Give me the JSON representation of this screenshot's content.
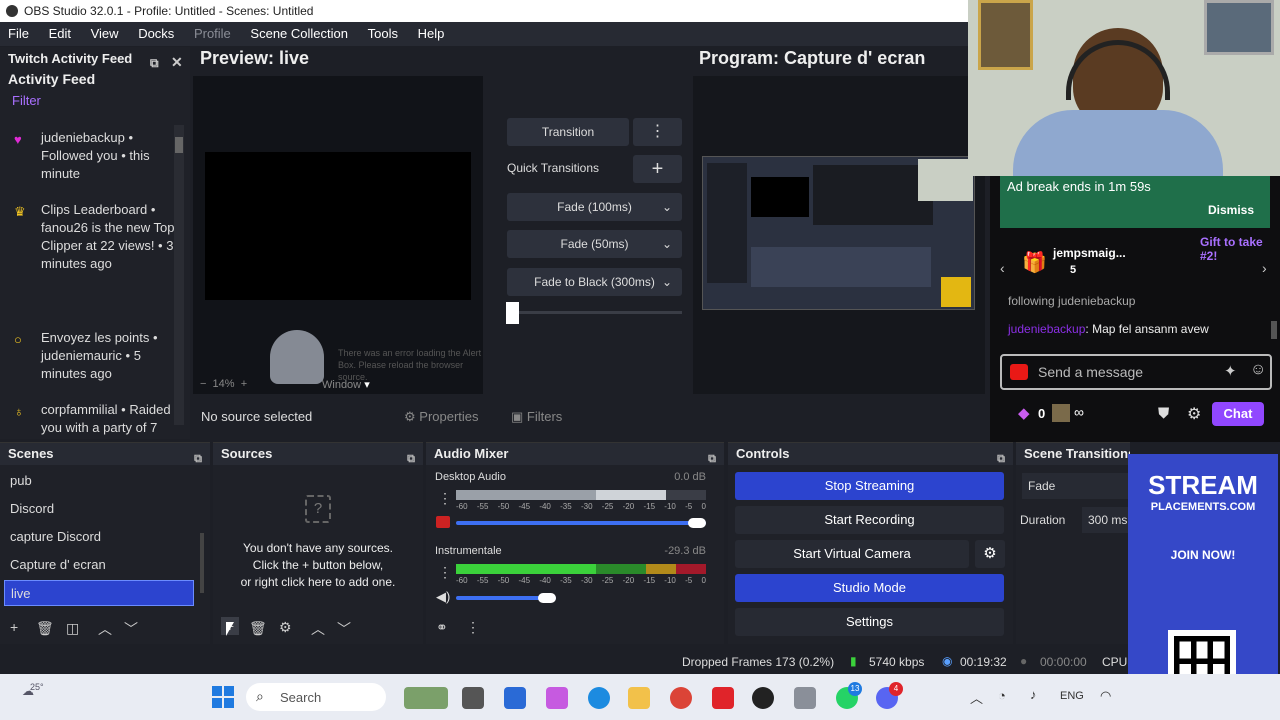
{
  "window": {
    "title": "OBS Studio 32.0.1 - Profile: Untitled - Scenes: Untitled"
  },
  "menu": {
    "items": [
      "File",
      "Edit",
      "View",
      "Docks",
      "Profile",
      "Scene Collection",
      "Tools",
      "Help"
    ]
  },
  "activity_feed": {
    "header": "Twitch Activity Feed",
    "subheader": "Activity Feed",
    "filter": "Filter",
    "items": [
      {
        "icon": "heart-icon",
        "text": "judeniebackup • Followed you • this minute"
      },
      {
        "icon": "crown-icon",
        "text": "Clips Leaderboard • fanou26 is the new Top Clipper at 22 views! • 3 minutes ago"
      },
      {
        "icon": "circle-icon",
        "text": "Envoyez les points • judeniemauric • 5 minutes ago"
      },
      {
        "icon": "bulb-icon",
        "text": "corpfammilial • Raided you with a party of 7"
      }
    ]
  },
  "preview": {
    "title": "Preview: live",
    "zoom": "14%",
    "window_label": "Window",
    "error_text": "There was an error loading the Alert Box. Please reload the browser source."
  },
  "program": {
    "title": "Program: Capture d' ecran"
  },
  "transitions": {
    "transition_button": "Transition",
    "quick_label": "Quick Transitions",
    "items": [
      "Fade (100ms)",
      "Fade (50ms)",
      "Fade to Black (300ms)"
    ]
  },
  "source_bar": {
    "no_source": "No source selected",
    "properties": "Properties",
    "filters": "Filters"
  },
  "scenes": {
    "header": "Scenes",
    "items": [
      "pub",
      "Discord",
      "capture Discord",
      "Capture d' ecran",
      "live"
    ],
    "selected": "live"
  },
  "sources": {
    "header": "Sources",
    "empty_text_1": "You don't have any sources.",
    "empty_text_2": "Click the + button below,",
    "empty_text_3": "or right click here to add one."
  },
  "audio_mixer": {
    "header": "Audio Mixer",
    "channels": [
      {
        "name": "Desktop Audio",
        "db": "0.0 dB",
        "volume": 1.0,
        "muted": true
      },
      {
        "name": "Instrumentale",
        "db": "-29.3 dB",
        "volume": 0.4,
        "muted": false
      }
    ],
    "ticks": [
      "-60",
      "-55",
      "-50",
      "-45",
      "-40",
      "-35",
      "-30",
      "-25",
      "-20",
      "-15",
      "-10",
      "-5",
      "0"
    ]
  },
  "controls": {
    "header": "Controls",
    "stop_streaming": "Stop Streaming",
    "start_recording": "Start Recording",
    "start_virtual_camera": "Start Virtual Camera",
    "studio_mode": "Studio Mode",
    "settings": "Settings"
  },
  "scene_transitions": {
    "header": "Scene Transitions",
    "value": "Fade",
    "duration_label": "Duration",
    "duration_value": "300 ms"
  },
  "status": {
    "dropped_frames": "Dropped Frames 173 (0.2%)",
    "bitrate": "5740 kbps",
    "stream_time": "00:19:32",
    "rec_time": "00:00:00",
    "cpu": "CPU:"
  },
  "chat": {
    "ad_break": "Ad break ends in 1m 59s",
    "dismiss": "Dismiss",
    "gift_user": "jempsmaig...",
    "gift_count": "5",
    "gift_text": "Gift to take #2!",
    "following_line": "following judeniebackup",
    "msg_user": "judeniebackup",
    "msg_text": ": Map fel ansanm avew",
    "placeholder": "Send a message",
    "points": "0",
    "chat_button": "Chat",
    "infinity": "∞"
  },
  "ad": {
    "line1": "STREAM",
    "line2": "PLACEMENTS.COM",
    "cta": "JOIN NOW!"
  },
  "taskbar": {
    "weather": "25°",
    "search": "Search",
    "lang": "ENG",
    "badge1": "13",
    "badge2": "4"
  },
  "colors": {
    "accent_blue": "#2c44cf",
    "twitch_purple": "#a970ff",
    "ad_green": "#1f6f4a"
  }
}
